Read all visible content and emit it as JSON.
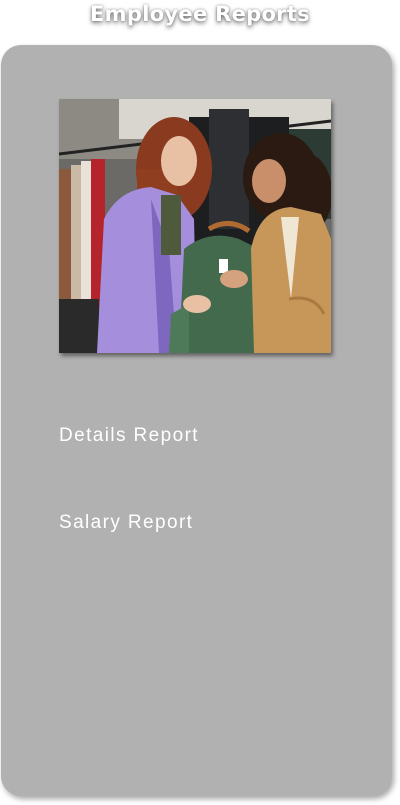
{
  "header": {
    "title": "Employee Reports"
  },
  "photo": {
    "icon": "shop-photo"
  },
  "menu": {
    "items": [
      {
        "label": "Details Report"
      },
      {
        "label": "Salary Report"
      }
    ]
  },
  "colors": {
    "panel": "#b1b1b1",
    "text": "#ffffff"
  }
}
